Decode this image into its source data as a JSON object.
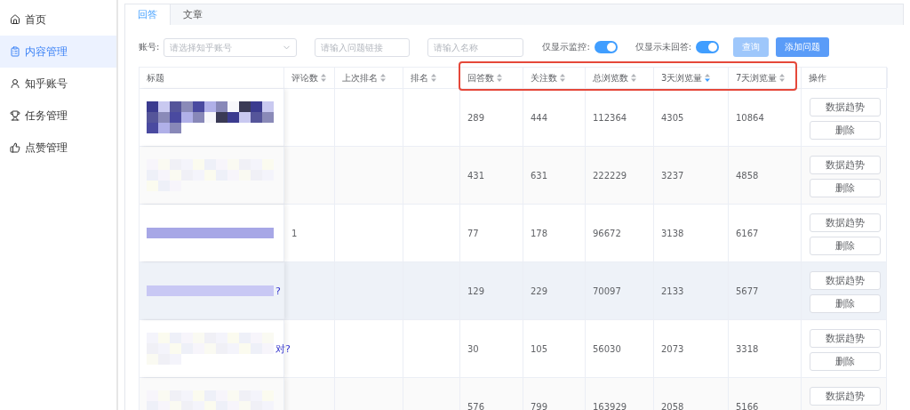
{
  "sidebar": {
    "items": [
      {
        "label": "首页",
        "selected": false
      },
      {
        "label": "内容管理",
        "selected": true
      },
      {
        "label": "知乎账号",
        "selected": false
      },
      {
        "label": "任务管理",
        "selected": false
      },
      {
        "label": "点赞管理",
        "selected": false
      }
    ]
  },
  "tabs": [
    {
      "label": "回答",
      "selected": true
    },
    {
      "label": "文章",
      "selected": false
    }
  ],
  "filters": {
    "account_label": "账号:",
    "account_placeholder": "请选择知乎账号",
    "link_placeholder": "请输入问题链接",
    "name_placeholder": "请输入名称",
    "switches": [
      {
        "label": "仅显示监控:",
        "on": true
      },
      {
        "label": "仅显示未回答:",
        "on": true
      }
    ],
    "buttons": [
      {
        "label": "查询",
        "kind": "light"
      },
      {
        "label": "添加问题",
        "kind": "primary"
      }
    ]
  },
  "table": {
    "columns": [
      {
        "label": "标题",
        "kind": "plain"
      },
      {
        "label": "评论数",
        "kind": "sortable",
        "sorted_desc": false
      },
      {
        "label": "上次排名",
        "kind": "sortable",
        "sorted_desc": false
      },
      {
        "label": "排名",
        "kind": "sortable",
        "sorted_desc": false
      },
      {
        "label": "回答数",
        "kind": "sortable",
        "sorted_desc": false,
        "highlighted": true
      },
      {
        "label": "关注数",
        "kind": "sortable",
        "sorted_desc": false,
        "highlighted": true
      },
      {
        "label": "总浏览数",
        "kind": "sortable",
        "sorted_desc": false,
        "highlighted": true
      },
      {
        "label": "3天浏览量",
        "kind": "sortable",
        "sorted_desc": true,
        "highlighted": true
      },
      {
        "label": "7天浏览量",
        "kind": "sortable",
        "sorted_desc": false,
        "highlighted": true
      },
      {
        "label": "操作",
        "kind": "plain"
      }
    ],
    "rows": [
      {
        "hovered": false,
        "cells": [
          "",
          "",
          "",
          "",
          "289",
          "444",
          "112364",
          "4305",
          "10864"
        ],
        "actions": [
          "数据趋势",
          "删除"
        ]
      },
      {
        "hovered": false,
        "cells": [
          "",
          "",
          "",
          "",
          "431",
          "631",
          "222229",
          "3237",
          "4858"
        ],
        "actions": [
          "数据趋势",
          "删除"
        ]
      },
      {
        "hovered": false,
        "cells": [
          "",
          "1",
          "",
          "",
          "77",
          "178",
          "96672",
          "3138",
          "6167"
        ],
        "actions": [
          "数据趋势",
          "删除"
        ]
      },
      {
        "hovered": true,
        "cells": [
          "?",
          "",
          "",
          "",
          "129",
          "229",
          "70097",
          "2133",
          "5677"
        ],
        "actions": [
          "数据趋势",
          "删除"
        ]
      },
      {
        "hovered": false,
        "cells": [
          "对?",
          "",
          "",
          "",
          "30",
          "105",
          "56030",
          "2073",
          "3318"
        ],
        "actions": [
          "数据趋势",
          "删除"
        ]
      },
      {
        "hovered": false,
        "cells": [
          "",
          "",
          "",
          "",
          "576",
          "799",
          "163929",
          "2058",
          "5166"
        ],
        "actions": [
          "数据趋势"
        ]
      }
    ]
  }
}
